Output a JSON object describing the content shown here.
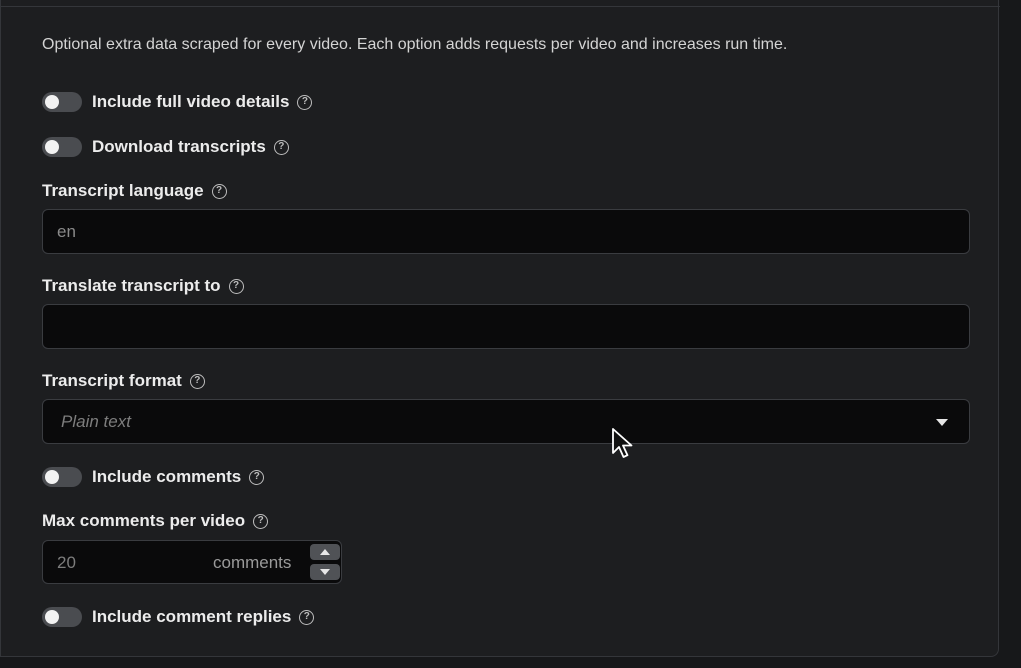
{
  "description": "Optional extra data scraped for every video. Each option adds requests per video and increases run time.",
  "help_glyph": "?",
  "toggles": {
    "full_details": {
      "label": "Include full video details",
      "checked": false
    },
    "transcripts": {
      "label": "Download transcripts",
      "checked": false
    },
    "comments": {
      "label": "Include comments",
      "checked": false
    },
    "replies": {
      "label": "Include comment replies",
      "checked": false
    }
  },
  "transcript_language": {
    "label": "Transcript language",
    "value": "en"
  },
  "translate_to": {
    "label": "Translate transcript to",
    "value": ""
  },
  "transcript_format": {
    "label": "Transcript format",
    "placeholder": "Plain text"
  },
  "max_comments": {
    "label": "Max comments per video",
    "placeholder": "20",
    "unit": "comments"
  },
  "colors": {
    "background": "#1d1e20",
    "input_bg": "#0a0a0b",
    "switch_off": "#4a4c50"
  }
}
